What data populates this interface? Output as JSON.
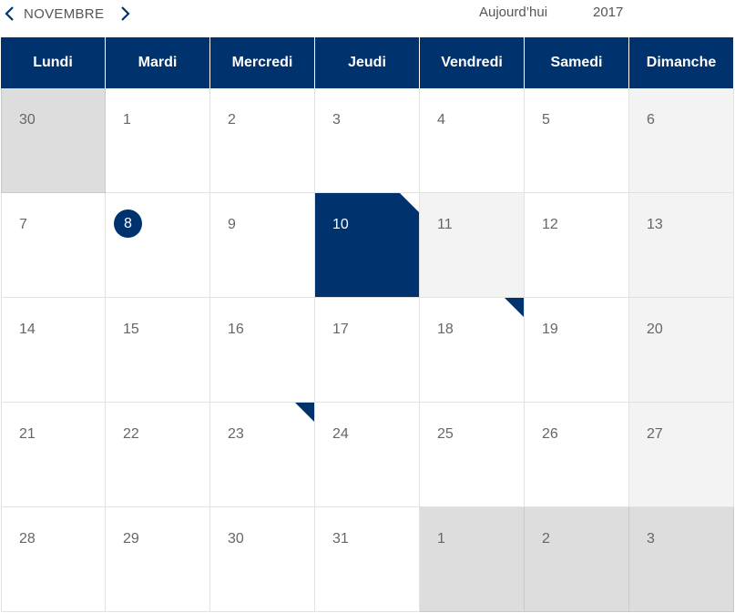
{
  "header": {
    "month": "NOVEMBRE",
    "today_label": "Aujourd’hui",
    "year": "2017"
  },
  "weekdays": [
    "Lundi",
    "Mardi",
    "Mercredi",
    "Jeudi",
    "Vendredi",
    "Samedi",
    "Dimanche"
  ],
  "weeks": [
    [
      {
        "d": "30",
        "s": "other"
      },
      {
        "d": "1"
      },
      {
        "d": "2"
      },
      {
        "d": "3"
      },
      {
        "d": "4"
      },
      {
        "d": "5"
      },
      {
        "d": "6",
        "s": "weekend"
      }
    ],
    [
      {
        "d": "7"
      },
      {
        "d": "8",
        "today": true
      },
      {
        "d": "9"
      },
      {
        "d": "10",
        "s": "selected",
        "flag": true
      },
      {
        "d": "11",
        "s": "weekend"
      },
      {
        "d": "12"
      },
      {
        "d": "13",
        "s": "weekend"
      }
    ],
    [
      {
        "d": "14"
      },
      {
        "d": "15"
      },
      {
        "d": "16"
      },
      {
        "d": "17"
      },
      {
        "d": "18",
        "flag": true
      },
      {
        "d": "19"
      },
      {
        "d": "20",
        "s": "weekend"
      }
    ],
    [
      {
        "d": "21"
      },
      {
        "d": "22"
      },
      {
        "d": "23",
        "flag": true
      },
      {
        "d": "24"
      },
      {
        "d": "25"
      },
      {
        "d": "26"
      },
      {
        "d": "27",
        "s": "weekend"
      }
    ],
    [
      {
        "d": "28"
      },
      {
        "d": "29"
      },
      {
        "d": "30"
      },
      {
        "d": "31"
      },
      {
        "d": "1",
        "s": "other"
      },
      {
        "d": "2",
        "s": "other"
      },
      {
        "d": "3",
        "s": "other"
      }
    ]
  ],
  "colors": {
    "primary": "#00326e",
    "weekend": "#f3f3f3",
    "other_month": "#dddddd"
  }
}
